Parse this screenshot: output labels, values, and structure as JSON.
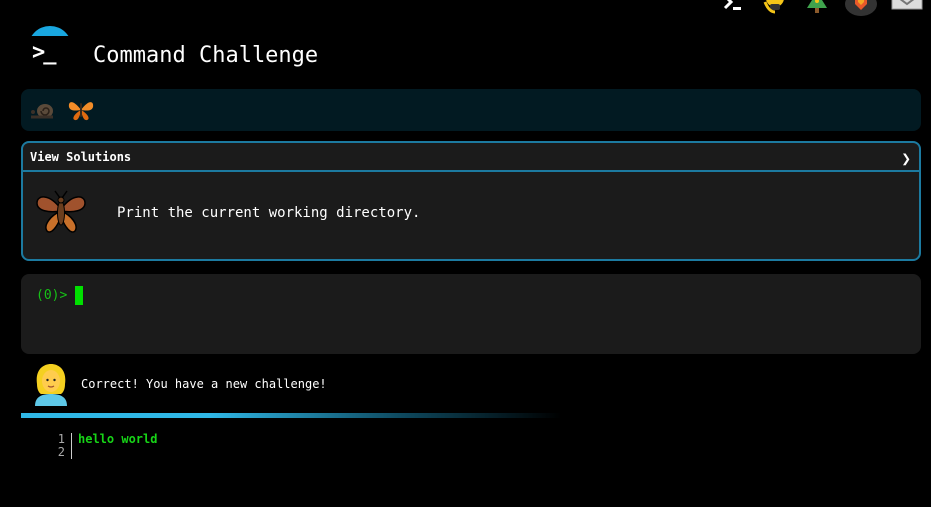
{
  "header": {
    "title": "Command Challenge",
    "logo_glyph": ">_"
  },
  "top_icons": [
    "command-prompt-icon",
    "lightbulb-hand-icon",
    "tree-icon",
    "badge-icon",
    "mail-icon"
  ],
  "progress": {
    "items": [
      "snail-icon",
      "butterfly-icon"
    ]
  },
  "challenge": {
    "view_solutions_label": "View Solutions",
    "chevron": "❯",
    "task": "Print the current working directory.",
    "icon": "moth-icon"
  },
  "terminal": {
    "prompt": "(0)>",
    "input_value": ""
  },
  "message": {
    "text": "Correct! You have a new challenge!",
    "avatar": "person-avatar-icon"
  },
  "editor": {
    "line_numbers": [
      "1",
      "2"
    ],
    "lines": [
      "hello world",
      ""
    ]
  },
  "colors": {
    "accent": "#19a7e0",
    "terminal_green": "#17c117",
    "panel_dark": "#1b1b1b",
    "progress_bg": "#021a22",
    "border_blue": "#1c7aa0"
  }
}
